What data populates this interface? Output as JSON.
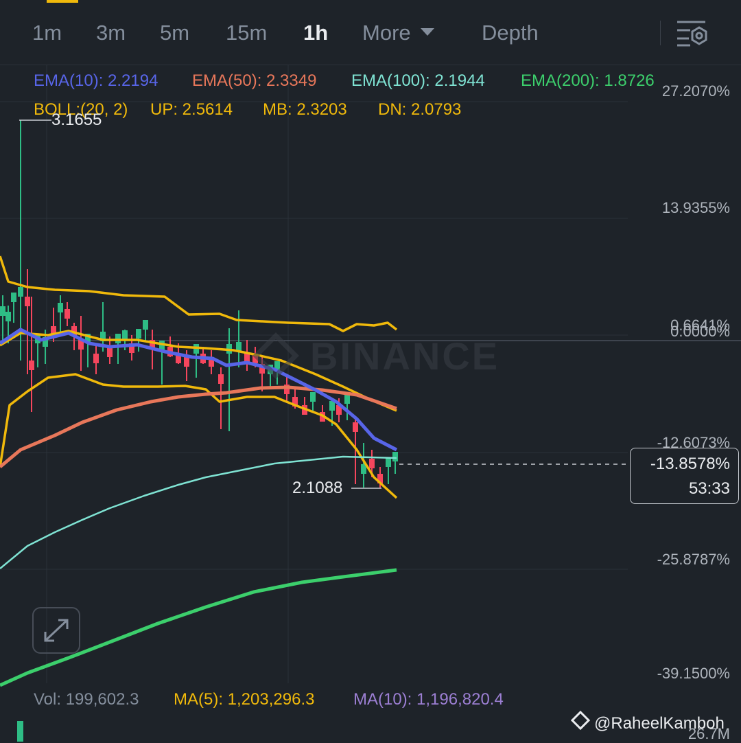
{
  "tabs": {
    "items": [
      {
        "label": "1m",
        "active": false
      },
      {
        "label": "3m",
        "active": false
      },
      {
        "label": "5m",
        "active": false
      },
      {
        "label": "15m",
        "active": false
      },
      {
        "label": "1h",
        "active": true
      },
      {
        "label": "More",
        "active": false
      },
      {
        "label": "Depth",
        "active": false
      }
    ],
    "settings_icon": "chart-settings-icon"
  },
  "indicators": {
    "ema": [
      {
        "label": "EMA(10): 2.2194",
        "color": "#5865e8"
      },
      {
        "label": "EMA(50): 2.3349",
        "color": "#e8775a"
      },
      {
        "label": "EMA(100): 2.1944",
        "color": "#7fe3d3"
      },
      {
        "label": "EMA(200): 1.8726",
        "color": "#3ccf6c"
      }
    ],
    "boll": [
      {
        "label": "BOLL:(20, 2)",
        "color": "#f0b90b"
      },
      {
        "label": "UP: 2.5614",
        "color": "#f0b90b"
      },
      {
        "label": "MB: 2.3203",
        "color": "#f0b90b"
      },
      {
        "label": "DN: 2.0793",
        "color": "#f0b90b"
      }
    ]
  },
  "axis": {
    "labels": [
      "27.2070%",
      "13.9355%",
      "0.6641%",
      "0.0000%",
      "-12.6073%",
      "-25.8787%",
      "-39.1500%"
    ]
  },
  "chart": {
    "high_label": "3.1655",
    "low_label": "2.1088",
    "current_change": "-13.8578%",
    "countdown": "53:33",
    "watermark": "BINANCE",
    "colors": {
      "up": "#2ebd85",
      "down": "#f6465d",
      "boll": "#f0b90b",
      "background": "#1e2329"
    }
  },
  "volume": {
    "vol": "Vol: 199,602.3",
    "ma5": "MA(5): 1,203,296.3",
    "ma10": "MA(10): 1,196,820.4",
    "axis_max": "26.7M",
    "ma5_color": "#f0b90b",
    "ma10_color": "#9c7fd3"
  },
  "footer": {
    "author": "@RaheelKamboh"
  },
  "expand_icon": "expand-icon"
}
